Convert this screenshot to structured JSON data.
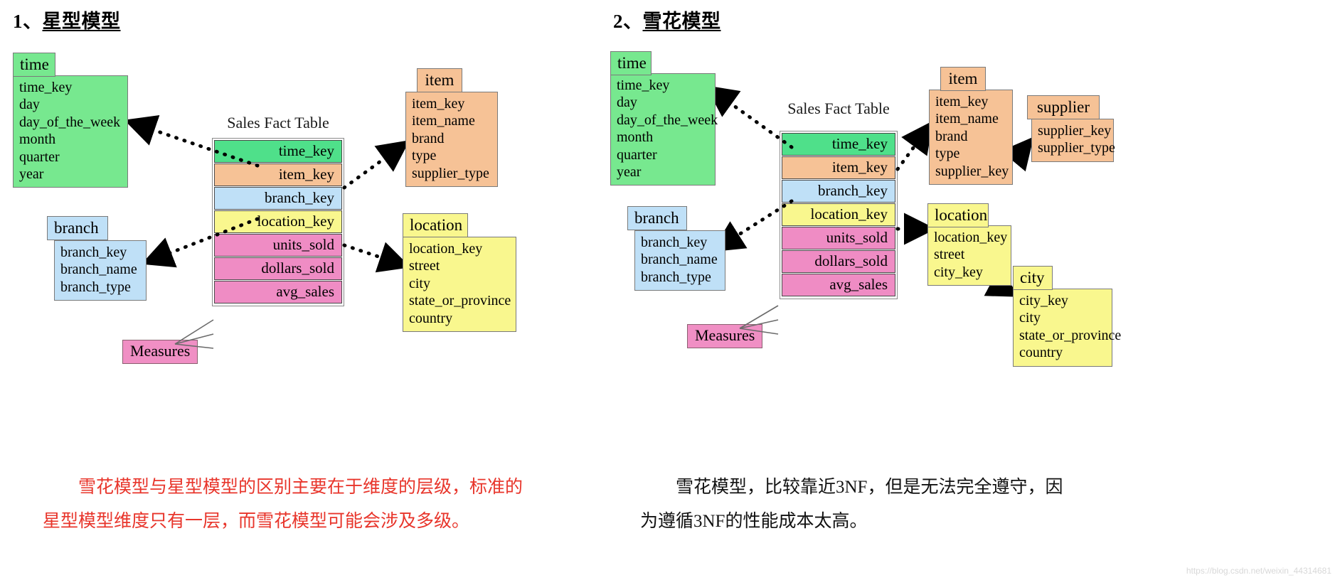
{
  "headings": {
    "left": {
      "num": "1、",
      "text": "星型模型"
    },
    "right": {
      "num": "2、",
      "text": "雪花模型"
    }
  },
  "colors": {
    "time": "#77e88f",
    "item": "#f6c296",
    "branch": "#bfe0f7",
    "location": "#f9f78e",
    "measures": "#f08fc4",
    "caption_red": "#e8352b"
  },
  "star": {
    "fact_title": "Sales Fact Table",
    "fact_rows": [
      {
        "label": "time_key",
        "color": "green"
      },
      {
        "label": "item_key",
        "color": "orange"
      },
      {
        "label": "branch_key",
        "color": "blue"
      },
      {
        "label": "location_key",
        "color": "yellow"
      },
      {
        "label": "units_sold",
        "color": "pink"
      },
      {
        "label": "dollars_sold",
        "color": "pink"
      },
      {
        "label": "avg_sales",
        "color": "pink"
      }
    ],
    "measures_label": "Measures",
    "time": {
      "title": "time",
      "fields": [
        "time_key",
        "day",
        "day_of_the_week",
        "month",
        "quarter",
        "year"
      ]
    },
    "branch": {
      "title": "branch",
      "fields": [
        "branch_key",
        "branch_name",
        "branch_type"
      ]
    },
    "item": {
      "title": "item",
      "fields": [
        "item_key",
        "item_name",
        "brand",
        "type",
        "supplier_type"
      ]
    },
    "location": {
      "title": "location",
      "fields": [
        "location_key",
        "street",
        "city",
        "state_or_province",
        "country"
      ]
    }
  },
  "snowflake": {
    "fact_title": "Sales Fact Table",
    "fact_rows": [
      {
        "label": "time_key",
        "color": "green"
      },
      {
        "label": "item_key",
        "color": "orange"
      },
      {
        "label": "branch_key",
        "color": "blue"
      },
      {
        "label": "location_key",
        "color": "yellow"
      },
      {
        "label": "units_sold",
        "color": "pink"
      },
      {
        "label": "dollars_sold",
        "color": "pink"
      },
      {
        "label": "avg_sales",
        "color": "pink"
      }
    ],
    "measures_label": "Measures",
    "time": {
      "title": "time",
      "fields": [
        "time_key",
        "day",
        "day_of_the_week",
        "month",
        "quarter",
        "year"
      ]
    },
    "branch": {
      "title": "branch",
      "fields": [
        "branch_key",
        "branch_name",
        "branch_type"
      ]
    },
    "item": {
      "title": "item",
      "fields": [
        "item_key",
        "item_name",
        "brand",
        "type",
        "supplier_key"
      ]
    },
    "supplier": {
      "title": "supplier",
      "fields": [
        "supplier_key",
        "supplier_type"
      ]
    },
    "location": {
      "title": "location",
      "fields": [
        "location_key",
        "street",
        "city_key"
      ]
    },
    "city": {
      "title": "city",
      "fields": [
        "city_key",
        "city",
        "state_or_province",
        "country"
      ]
    }
  },
  "captions": {
    "left": "　　雪花模型与星型模型的区别主要在于维度的层级，标准的\n星型模型维度只有一层，而雪花模型可能会涉及多级。",
    "right": "　　雪花模型，比较靠近3NF，但是无法完全遵守，因\n为遵循3NF的性能成本太高。"
  },
  "watermark": "https://blog.csdn.net/weixin_44314681"
}
